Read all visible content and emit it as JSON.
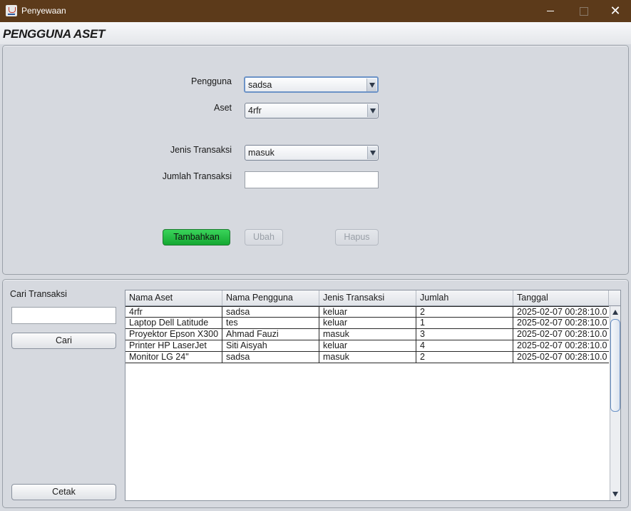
{
  "window": {
    "title": "Penyewaan",
    "controls": {
      "minimize_icon": "minimize-icon",
      "maximize_icon": "maximize-icon",
      "close_icon": "close-icon",
      "close_glyph": "✕"
    }
  },
  "header": {
    "title": "PENGGUNA ASET"
  },
  "form": {
    "pengguna": {
      "label": "Pengguna",
      "value": "sadsa"
    },
    "aset": {
      "label": "Aset",
      "value": "4rfr"
    },
    "jenis_transaksi": {
      "label": "Jenis Transaksi",
      "value": "masuk"
    },
    "jumlah_transaksi": {
      "label": "Jumlah Transaksi",
      "value": ""
    },
    "buttons": {
      "tambahkan": "Tambahkan",
      "ubah": "Ubah",
      "hapus": "Hapus"
    }
  },
  "search": {
    "label": "Cari Transaksi",
    "value": "",
    "cari_button": "Cari",
    "cetak_button": "Cetak"
  },
  "table": {
    "columns": [
      "Nama Aset",
      "Nama Pengguna",
      "Jenis Transaksi",
      "Jumlah",
      "Tanggal"
    ],
    "rows": [
      [
        "4rfr",
        "sadsa",
        "keluar",
        "2",
        "2025-02-07 00:28:10.0"
      ],
      [
        "Laptop Dell Latitude",
        "tes",
        "keluar",
        "1",
        "2025-02-07 00:28:10.0"
      ],
      [
        "Proyektor Epson X300",
        "Ahmad Fauzi",
        "masuk",
        "3",
        "2025-02-07 00:28:10.0"
      ],
      [
        "Printer HP LaserJet",
        "Siti Aisyah",
        "keluar",
        "4",
        "2025-02-07 00:28:10.0"
      ],
      [
        "Monitor LG 24\"",
        "sadsa",
        "masuk",
        "2",
        "2025-02-07 00:28:10.0"
      ]
    ]
  },
  "colors": {
    "titlebar": "#5c3a1a",
    "panel": "#d6d9df",
    "accent_green": "#14a832",
    "focus_border": "#6c93c7"
  }
}
